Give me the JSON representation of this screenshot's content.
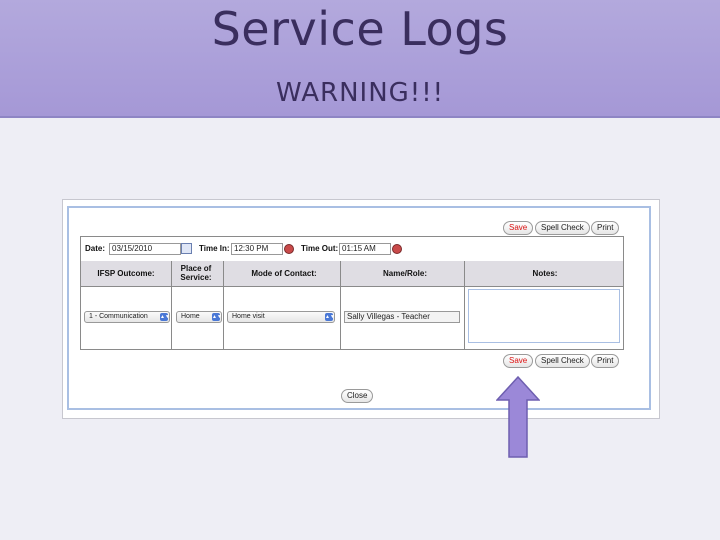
{
  "slide": {
    "title": "Service Logs",
    "subtitle": "WARNING!!!"
  },
  "form": {
    "top_buttons": {
      "save": "Save",
      "spell_check": "Spell Check",
      "print": "Print"
    },
    "date_label": "Date:",
    "date_value": "03/15/2010",
    "time_in_label": "Time In:",
    "time_in_value": "12:30 PM",
    "time_out_label": "Time Out:",
    "time_out_value": "01:15 AM",
    "columns": {
      "ifsp_outcome": "IFSP Outcome:",
      "place_of_service": "Place of Service:",
      "mode_of_contact": "Mode of Contact:",
      "name_role": "Name/Role:",
      "notes": "Notes:"
    },
    "row": {
      "ifsp_outcome": "1 - Communication",
      "place_of_service": "Home",
      "mode_of_contact": "Home visit",
      "name_role": "Sally Villegas - Teacher",
      "notes": ""
    },
    "bottom_buttons": {
      "save": "Save",
      "spell_check": "Spell Check",
      "print": "Print"
    },
    "close_button": "Close"
  },
  "colors": {
    "header_band": "#a89bd8",
    "save_text": "#dd1111",
    "arrow_fill": "#9b88d8"
  },
  "icons": [
    "calendar-icon",
    "clock-icon",
    "select-arrow-icon",
    "up-arrow-icon"
  ]
}
